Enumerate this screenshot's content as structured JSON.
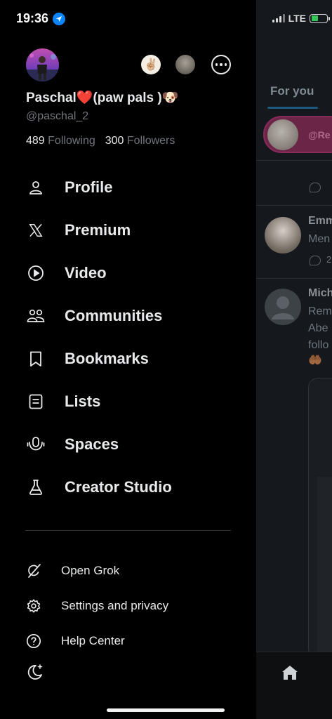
{
  "status_bar": {
    "time": "19:36",
    "network": "LTE"
  },
  "profile": {
    "display_name": "Paschal❤️(paw pals )🐶",
    "handle": "@paschal_2",
    "following_count": "489",
    "following_label": "Following",
    "followers_count": "300",
    "followers_label": "Followers",
    "account_switcher_emoji": "✌🏼"
  },
  "nav": {
    "items": [
      {
        "label": "Profile",
        "icon": "person-icon"
      },
      {
        "label": "Premium",
        "icon": "x-logo-icon"
      },
      {
        "label": "Video",
        "icon": "play-circle-icon"
      },
      {
        "label": "Communities",
        "icon": "communities-icon"
      },
      {
        "label": "Bookmarks",
        "icon": "bookmark-icon"
      },
      {
        "label": "Lists",
        "icon": "list-icon"
      },
      {
        "label": "Spaces",
        "icon": "spaces-mic-icon"
      },
      {
        "label": "Creator Studio",
        "icon": "flask-icon"
      }
    ]
  },
  "secondary": {
    "items": [
      {
        "label": "Open Grok",
        "icon": "grok-icon"
      },
      {
        "label": "Settings and privacy",
        "icon": "gear-icon"
      },
      {
        "label": "Help Center",
        "icon": "help-icon"
      }
    ],
    "theme_icon": "moon-icon"
  },
  "timeline_bg": {
    "tab_label": "For you",
    "space_pill_text": "@Re",
    "posts": [
      {
        "name": "Emm",
        "text": "Men",
        "reply_count": "2"
      },
      {
        "name": "Mich",
        "lines": [
          "Rem",
          "Abe",
          "follo"
        ]
      }
    ]
  },
  "colors": {
    "drawer_bg": "#000000",
    "text_primary": "#e7e9ea",
    "text_secondary": "#71767b",
    "accent_blue": "#1d9bf0",
    "location_blue": "#0a84ff",
    "battery_green": "#35c759"
  }
}
